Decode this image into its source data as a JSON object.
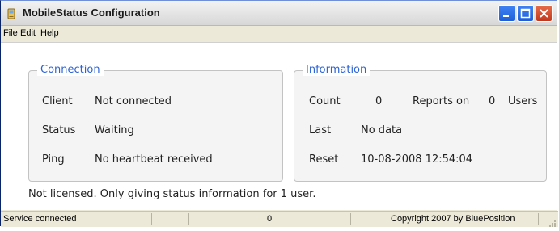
{
  "window": {
    "title": "MobileStatus Configuration",
    "icon": "app-icon"
  },
  "menu": [
    "File",
    "Edit",
    "Help"
  ],
  "connection": {
    "title": "Connection",
    "client_label": "Client",
    "client_value": "Not connected",
    "status_label": "Status",
    "status_value": "Waiting",
    "ping_label": "Ping",
    "ping_value": "No heartbeat received"
  },
  "information": {
    "title": "Information",
    "count_label": "Count",
    "count_value": "0",
    "reports_label": "Reports on",
    "reports_value": "0",
    "users_label": "Users",
    "last_label": "Last",
    "last_value": "No data",
    "reset_label": "Reset",
    "reset_value": "10-08-2008 12:54:04"
  },
  "notice": "Not licensed. Only giving status information for 1 user.",
  "statusbar": {
    "service": "Service connected",
    "count": "0",
    "copyright": "Copyright 2007 by BluePosition"
  },
  "colors": {
    "group_title": "#2c63d6",
    "close_button": "#c0391e",
    "title_buttons": "#1f5fd6"
  }
}
